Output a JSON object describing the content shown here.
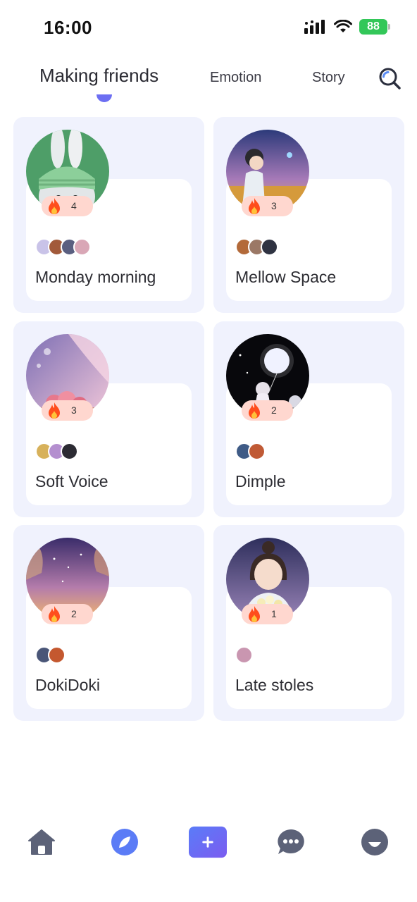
{
  "status_bar": {
    "time": "16:00",
    "battery": "88"
  },
  "tabs": [
    {
      "label": "Making friends",
      "active": true
    },
    {
      "label": "Emotion",
      "active": false
    },
    {
      "label": "Story",
      "active": false
    }
  ],
  "cards": [
    {
      "title": "Monday morning",
      "heat": "4",
      "member_colors": [
        "#c9c3e8",
        "#a25a3a",
        "#5a5f80",
        "#d9a7b6"
      ]
    },
    {
      "title": "Mellow Space",
      "heat": "3",
      "member_colors": [
        "#b36a3a",
        "#9b7866",
        "#2f3342"
      ]
    },
    {
      "title": "Soft Voice",
      "heat": "3",
      "member_colors": [
        "#d7b15b",
        "#b48fcf",
        "#2c2b33"
      ]
    },
    {
      "title": "Dimple",
      "heat": "2",
      "member_colors": [
        "#3f5b86",
        "#c05a35"
      ]
    },
    {
      "title": "DokiDoki",
      "heat": "2",
      "member_colors": [
        "#4a5678",
        "#c4582f"
      ]
    },
    {
      "title": "Late stoles",
      "heat": "1",
      "member_colors": [
        "#c996b0"
      ]
    }
  ],
  "icons": {
    "search": "search-icon",
    "heat": "fire-icon",
    "nav": [
      "home-icon",
      "discover-icon",
      "add-icon",
      "chat-icon",
      "profile-icon"
    ]
  },
  "colors": {
    "accent": "#6c6ef2",
    "card_bg": "#f0f2fd",
    "heat_badge": "#ffd7cf",
    "nav_icon": "#5c6278"
  }
}
